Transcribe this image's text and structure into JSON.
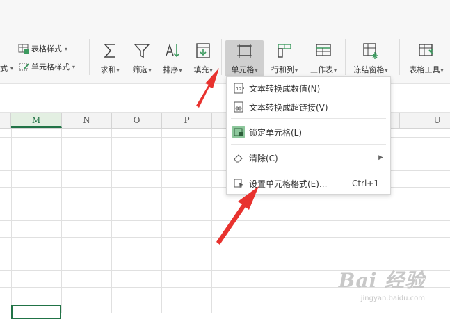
{
  "toolbar": {
    "style_partial": "式",
    "table_style": "表格样式",
    "cell_style": "单元格样式",
    "sum": "求和",
    "filter": "筛选",
    "sort": "排序",
    "fill": "填充",
    "cell": "单元格",
    "row_col": "行和列",
    "worksheet": "工作表",
    "freeze": "冻结窗格",
    "table_tools": "表格工具"
  },
  "columns": [
    "M",
    "N",
    "O",
    "P",
    "U"
  ],
  "menu": {
    "items": [
      {
        "label": "文本转换成数值(N)"
      },
      {
        "label": "文本转换成超链接(V)"
      },
      {
        "label": "锁定单元格(L)"
      },
      {
        "label": "清除(C)"
      },
      {
        "label": "设置单元格格式(E)...",
        "shortcut": "Ctrl+1"
      }
    ]
  },
  "watermark": {
    "brand": "Bai 经验",
    "url": "jingyan.baidu.com"
  },
  "colors": {
    "accent": "#217346",
    "arrow": "#e8322e"
  }
}
